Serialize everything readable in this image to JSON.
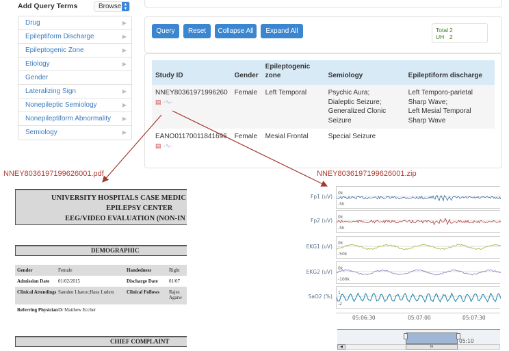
{
  "sidebar": {
    "title": "Add Query Terms",
    "mode_select": "Browse",
    "items": [
      {
        "label": "Drug",
        "has_children": true
      },
      {
        "label": "Epileptiform Discharge",
        "has_children": true
      },
      {
        "label": "Epileptogenic Zone",
        "has_children": true
      },
      {
        "label": "Etiology",
        "has_children": true
      },
      {
        "label": "Gender",
        "has_children": false
      },
      {
        "label": "Lateralizing Sign",
        "has_children": true
      },
      {
        "label": "Nonepileptic Semiology",
        "has_children": true
      },
      {
        "label": "Nonepileptiform Abnormality",
        "has_children": true
      },
      {
        "label": "Semiology",
        "has_children": true
      }
    ]
  },
  "toolbar": {
    "query": "Query",
    "reset": "Reset",
    "collapse_all": "Collapse All",
    "expand_all": "Expand All"
  },
  "stats": {
    "total_label": "Total",
    "total": "2",
    "uh_label": "UH",
    "uh": "2"
  },
  "results": {
    "headers": [
      "Study ID",
      "Gender",
      "Epileptogenic zone",
      "Semiology",
      "Epileptiform discharge"
    ],
    "rows": [
      {
        "study_id": "NNEY80361971996260",
        "gender": "Female",
        "zone": "Left Temporal",
        "semiology": [
          "Psychic Aura;",
          "Dialeptic Seizure;",
          "Generalized Clonic Seizure"
        ],
        "discharge": [
          "Left Temporo-parietal Sharp Wave;",
          "Left Mesial Temporal Sharp Wave"
        ]
      },
      {
        "study_id": "EANO01170011841696",
        "gender": "Female",
        "zone": "Mesial Frontal",
        "semiology": [
          "Special Seizure"
        ],
        "discharge": []
      }
    ]
  },
  "pdf": {
    "filename": "NNEY8036197199626001.pdf",
    "header": [
      "UNIVERSITY HOSPITALS CASE MEDIC",
      "EPILEPSY CENTER",
      "EEG/VIDEO EVALUATION (NON-IN"
    ],
    "demographic_title": "DEMOGRAPHIC",
    "demographic": [
      [
        "Gender",
        "Female",
        "Handedness",
        "Right"
      ],
      [
        "Admission Date",
        "01/02/2015",
        "Discharge Date",
        "01/07"
      ],
      [
        "Clinical Attendings",
        "Samden Lhatoo;Hans Luders",
        "Clinical Follows",
        "Rajes Agarw"
      ],
      [
        "Referring Physician",
        "Dr Matthew Eccher",
        "",
        ""
      ]
    ],
    "chief_complaint_title": "CHIEF COMPLAINT"
  },
  "eeg": {
    "filename": "NNEY8036197199626001.zip",
    "channels": [
      {
        "label": "Fp1 (uV)",
        "top_tick": "0k",
        "bottom_tick": "-5k",
        "color": "#3c6aa8"
      },
      {
        "label": "Fp2 (uV)",
        "top_tick": "0k",
        "bottom_tick": "-5k",
        "color": "#b03a3a"
      },
      {
        "label": "EKG1 (uV)",
        "top_tick": "0k",
        "bottom_tick": "-50k",
        "color": "#a8b040"
      },
      {
        "label": "EKG2 (uV)",
        "top_tick": "0k",
        "bottom_tick": "-100k",
        "color": "#8a78b8"
      },
      {
        "label": "SaO2 (%)",
        "top_tick": "1",
        "bottom_tick": "-2",
        "color": "#2a8ab0"
      }
    ],
    "time_ticks": [
      "05:06:30",
      "05:07:00",
      "05:07:30"
    ],
    "navigator_label": "05:10"
  },
  "colors": {
    "accent": "#3b86d0",
    "annotation": "#b23a2e",
    "stats_text": "#3c7a1e",
    "table_header": "#d9eaf7"
  }
}
